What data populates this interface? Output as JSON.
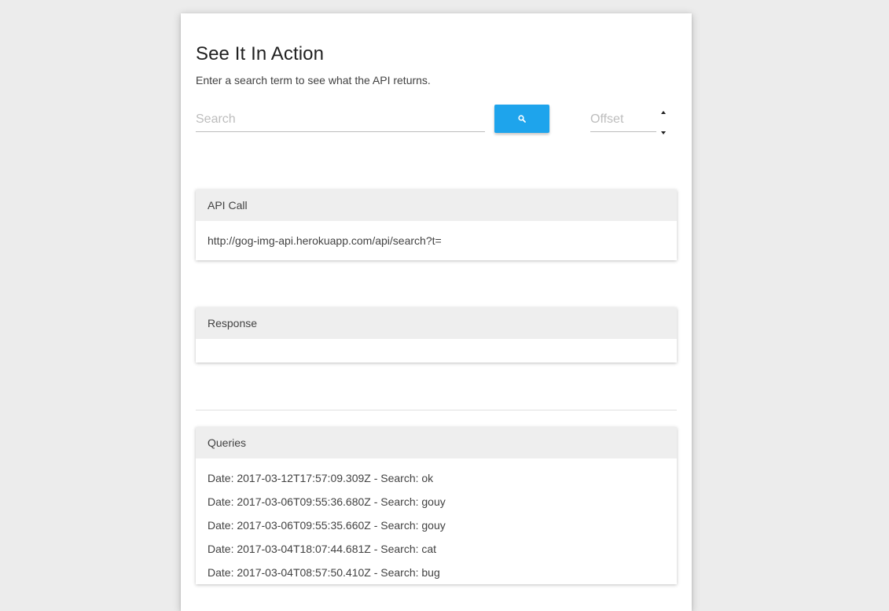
{
  "header": {
    "title": "See It In Action",
    "subtitle": "Enter a search term to see what the API returns."
  },
  "search": {
    "placeholder": "Search",
    "value": "",
    "button_icon": "search-icon",
    "offset_placeholder": "Offset",
    "offset_value": ""
  },
  "api_call": {
    "title": "API Call",
    "url": "http://gog-img-api.herokuapp.com/api/search?t="
  },
  "response": {
    "title": "Response",
    "body": ""
  },
  "queries": {
    "title": "Queries",
    "items": [
      "Date: 2017-03-12T17:57:09.309Z - Search: ok",
      "Date: 2017-03-06T09:55:36.680Z - Search: gouy",
      "Date: 2017-03-06T09:55:35.660Z - Search: gouy",
      "Date: 2017-03-04T18:07:44.681Z - Search: cat",
      "Date: 2017-03-04T08:57:50.410Z - Search: bug"
    ]
  },
  "colors": {
    "accent": "#1ea4ec",
    "panel_header": "#eeeeee",
    "background": "#ececec"
  }
}
